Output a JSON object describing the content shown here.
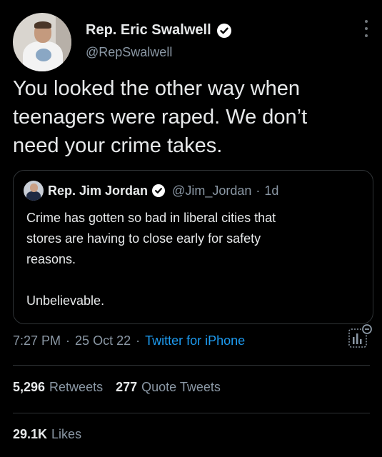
{
  "author": {
    "name": "Rep. Eric Swalwell",
    "handle": "@RepSwalwell"
  },
  "tweet": {
    "text": "You looked the other way when\nteenagers were raped. We don’t\nneed your crime takes."
  },
  "quoted": {
    "name": "Rep. Jim Jordan",
    "handle": "@Jim_Jordan",
    "separator": "·",
    "time": "1d",
    "text": "Crime has gotten so bad in liberal cities that\nstores are having to close early for safety\nreasons.\n\nUnbelievable."
  },
  "meta": {
    "time": "7:27 PM",
    "sep1": "·",
    "date": "25 Oct 22",
    "sep2": "·",
    "source": "Twitter for iPhone"
  },
  "stats": {
    "retweets_count": "5,296",
    "retweets_label": "Retweets",
    "quotes_count": "277",
    "quotes_label": "Quote Tweets",
    "likes_count": "29.1K",
    "likes_label": "Likes"
  },
  "icons": {
    "verified": "verified-badge-icon",
    "more": "more-dots-icon",
    "analytics": "analytics-icon"
  },
  "colors": {
    "background": "#000000",
    "text": "#e7e9ea",
    "muted": "#8b98a5",
    "link": "#1d9bf0",
    "border": "#2f3336"
  }
}
